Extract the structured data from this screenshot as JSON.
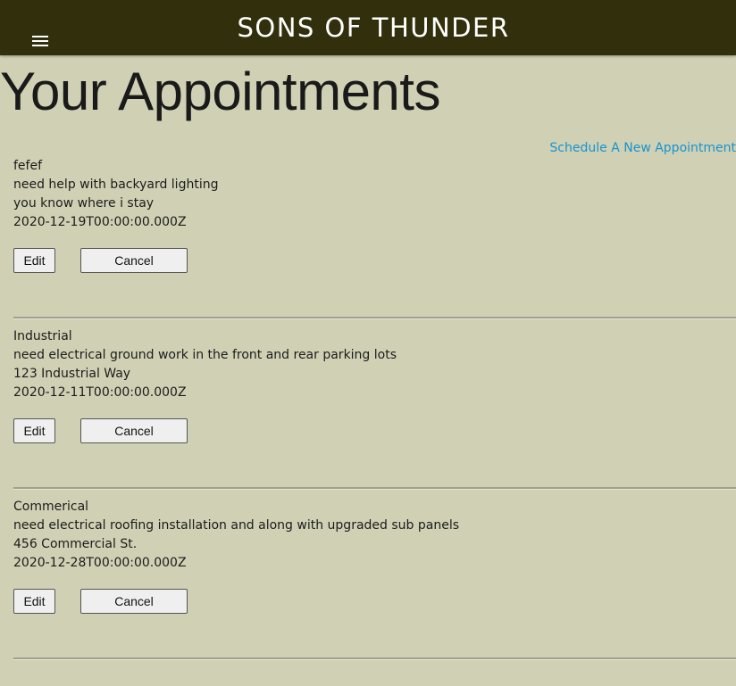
{
  "header": {
    "menu_icon": "hamburger-menu-icon",
    "brand": "SONS OF THUNDER",
    "colors": {
      "bar": "#32300c",
      "text": "#ffffff"
    }
  },
  "page": {
    "title": "Your Appointments",
    "schedule_link": "Schedule A New Appointment",
    "colors": {
      "background": "#d0d1b4",
      "link": "#1793d1"
    }
  },
  "appointments": [
    {
      "title": "fefef",
      "description": "need help with backyard lighting",
      "address": "you know where i stay",
      "date": "2020-12-19T00:00:00.000Z",
      "edit_label": "Edit",
      "cancel_label": "Cancel"
    },
    {
      "title": "Industrial",
      "description": "need electrical ground work in the front and rear parking lots",
      "address": "123 Industrial Way",
      "date": "2020-12-11T00:00:00.000Z",
      "edit_label": "Edit",
      "cancel_label": "Cancel"
    },
    {
      "title": "Commerical",
      "description": "need electrical roofing installation and along with upgraded sub panels",
      "address": "456 Commercial St.",
      "date": "2020-12-28T00:00:00.000Z",
      "edit_label": "Edit",
      "cancel_label": "Cancel"
    }
  ]
}
